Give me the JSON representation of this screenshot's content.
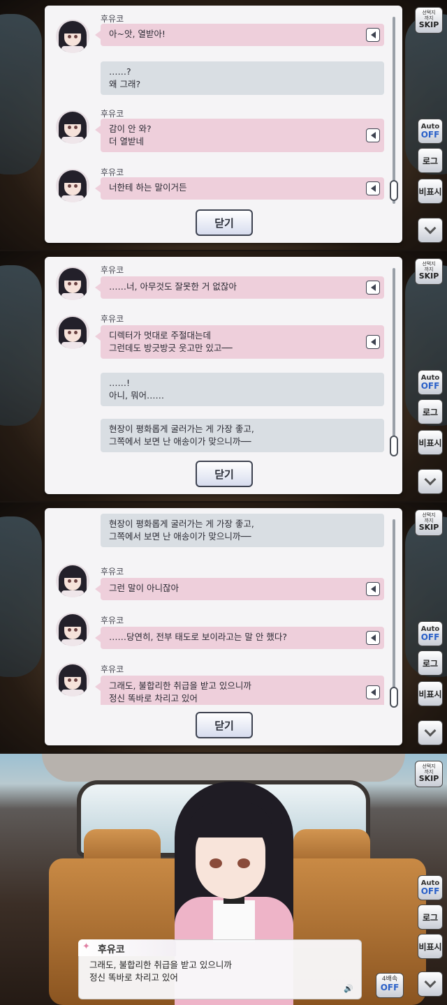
{
  "colors": {
    "bubble_pink": "#eecfdb",
    "bubble_gray": "#d9dee3",
    "off_blue": "#2a60c8"
  },
  "side": {
    "skip_small": "선택지\n까지",
    "skip": "SKIP",
    "auto": "Auto",
    "off": "OFF",
    "log": "로그",
    "hide": "비표시"
  },
  "close_label": "닫기",
  "panel1": {
    "entries": [
      {
        "speaker": "후유코",
        "lines": [
          "아~앗, 열받아!"
        ]
      },
      {
        "lines": [
          "……?",
          "왜 그래?"
        ]
      },
      {
        "speaker": "후유코",
        "lines": [
          "감이 안 와?",
          "더 열받네"
        ]
      },
      {
        "speaker": "후유코",
        "lines": [
          "너한테 하는 말이거든"
        ]
      }
    ]
  },
  "panel2": {
    "entries": [
      {
        "speaker": "후유코",
        "lines": [
          "……너, 아무것도 잘못한 거 없잖아"
        ]
      },
      {
        "speaker": "후유코",
        "lines": [
          "디렉터가 멋대로 주절대는데",
          "그런데도 방긋방긋 웃고만 있고──"
        ]
      },
      {
        "lines": [
          "……!",
          "아니, 뭐어……"
        ]
      },
      {
        "lines": [
          "현장이 평화롭게 굴러가는 게 가장 좋고,",
          "그쪽에서 보면 난 애송이가 맞으니까──"
        ]
      }
    ]
  },
  "panel3": {
    "entries": [
      {
        "lines": [
          "현장이 평화롭게 굴러가는 게 가장 좋고,",
          "그쪽에서 보면 난 애송이가 맞으니까──"
        ]
      },
      {
        "speaker": "후유코",
        "lines": [
          "그런 말이 아니잖아"
        ]
      },
      {
        "speaker": "후유코",
        "lines": [
          "……당연히, 전부 태도로 보이라고는 말 안 했다?"
        ]
      },
      {
        "speaker": "후유코",
        "lines": [
          "그래도, 불합리한 취급을 받고 있으니까",
          "정신 똑바로 차리고 있어"
        ]
      }
    ]
  },
  "scene": {
    "speaker": "후유코",
    "line1": "그래도, 불합리한 취급을 받고 있으니까",
    "line2": "정신 똑바로 차리고 있어",
    "speed_top": "4배속",
    "speed_off": "OFF"
  }
}
